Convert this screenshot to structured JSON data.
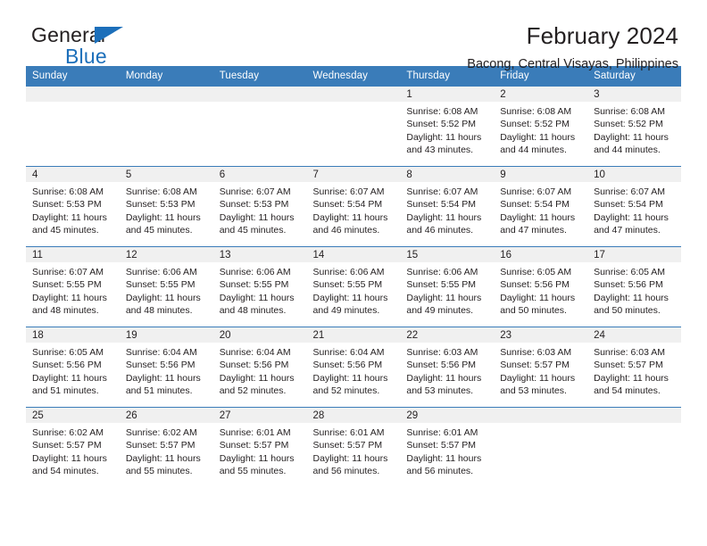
{
  "brand": {
    "name_top": "General",
    "name_bottom": "Blue",
    "triangle_color": "#1c6fba"
  },
  "header": {
    "title": "February 2024",
    "subtitle": "Bacong, Central Visayas, Philippines",
    "accent_color": "#3a7cb9"
  },
  "calendar": {
    "weekday_headers": [
      "Sunday",
      "Monday",
      "Tuesday",
      "Wednesday",
      "Thursday",
      "Friday",
      "Saturday"
    ],
    "weeks": [
      [
        {
          "day": "",
          "lines": []
        },
        {
          "day": "",
          "lines": []
        },
        {
          "day": "",
          "lines": []
        },
        {
          "day": "",
          "lines": []
        },
        {
          "day": "1",
          "lines": [
            "Sunrise: 6:08 AM",
            "Sunset: 5:52 PM",
            "Daylight: 11 hours",
            "and 43 minutes."
          ]
        },
        {
          "day": "2",
          "lines": [
            "Sunrise: 6:08 AM",
            "Sunset: 5:52 PM",
            "Daylight: 11 hours",
            "and 44 minutes."
          ]
        },
        {
          "day": "3",
          "lines": [
            "Sunrise: 6:08 AM",
            "Sunset: 5:52 PM",
            "Daylight: 11 hours",
            "and 44 minutes."
          ]
        }
      ],
      [
        {
          "day": "4",
          "lines": [
            "Sunrise: 6:08 AM",
            "Sunset: 5:53 PM",
            "Daylight: 11 hours",
            "and 45 minutes."
          ]
        },
        {
          "day": "5",
          "lines": [
            "Sunrise: 6:08 AM",
            "Sunset: 5:53 PM",
            "Daylight: 11 hours",
            "and 45 minutes."
          ]
        },
        {
          "day": "6",
          "lines": [
            "Sunrise: 6:07 AM",
            "Sunset: 5:53 PM",
            "Daylight: 11 hours",
            "and 45 minutes."
          ]
        },
        {
          "day": "7",
          "lines": [
            "Sunrise: 6:07 AM",
            "Sunset: 5:54 PM",
            "Daylight: 11 hours",
            "and 46 minutes."
          ]
        },
        {
          "day": "8",
          "lines": [
            "Sunrise: 6:07 AM",
            "Sunset: 5:54 PM",
            "Daylight: 11 hours",
            "and 46 minutes."
          ]
        },
        {
          "day": "9",
          "lines": [
            "Sunrise: 6:07 AM",
            "Sunset: 5:54 PM",
            "Daylight: 11 hours",
            "and 47 minutes."
          ]
        },
        {
          "day": "10",
          "lines": [
            "Sunrise: 6:07 AM",
            "Sunset: 5:54 PM",
            "Daylight: 11 hours",
            "and 47 minutes."
          ]
        }
      ],
      [
        {
          "day": "11",
          "lines": [
            "Sunrise: 6:07 AM",
            "Sunset: 5:55 PM",
            "Daylight: 11 hours",
            "and 48 minutes."
          ]
        },
        {
          "day": "12",
          "lines": [
            "Sunrise: 6:06 AM",
            "Sunset: 5:55 PM",
            "Daylight: 11 hours",
            "and 48 minutes."
          ]
        },
        {
          "day": "13",
          "lines": [
            "Sunrise: 6:06 AM",
            "Sunset: 5:55 PM",
            "Daylight: 11 hours",
            "and 48 minutes."
          ]
        },
        {
          "day": "14",
          "lines": [
            "Sunrise: 6:06 AM",
            "Sunset: 5:55 PM",
            "Daylight: 11 hours",
            "and 49 minutes."
          ]
        },
        {
          "day": "15",
          "lines": [
            "Sunrise: 6:06 AM",
            "Sunset: 5:55 PM",
            "Daylight: 11 hours",
            "and 49 minutes."
          ]
        },
        {
          "day": "16",
          "lines": [
            "Sunrise: 6:05 AM",
            "Sunset: 5:56 PM",
            "Daylight: 11 hours",
            "and 50 minutes."
          ]
        },
        {
          "day": "17",
          "lines": [
            "Sunrise: 6:05 AM",
            "Sunset: 5:56 PM",
            "Daylight: 11 hours",
            "and 50 minutes."
          ]
        }
      ],
      [
        {
          "day": "18",
          "lines": [
            "Sunrise: 6:05 AM",
            "Sunset: 5:56 PM",
            "Daylight: 11 hours",
            "and 51 minutes."
          ]
        },
        {
          "day": "19",
          "lines": [
            "Sunrise: 6:04 AM",
            "Sunset: 5:56 PM",
            "Daylight: 11 hours",
            "and 51 minutes."
          ]
        },
        {
          "day": "20",
          "lines": [
            "Sunrise: 6:04 AM",
            "Sunset: 5:56 PM",
            "Daylight: 11 hours",
            "and 52 minutes."
          ]
        },
        {
          "day": "21",
          "lines": [
            "Sunrise: 6:04 AM",
            "Sunset: 5:56 PM",
            "Daylight: 11 hours",
            "and 52 minutes."
          ]
        },
        {
          "day": "22",
          "lines": [
            "Sunrise: 6:03 AM",
            "Sunset: 5:56 PM",
            "Daylight: 11 hours",
            "and 53 minutes."
          ]
        },
        {
          "day": "23",
          "lines": [
            "Sunrise: 6:03 AM",
            "Sunset: 5:57 PM",
            "Daylight: 11 hours",
            "and 53 minutes."
          ]
        },
        {
          "day": "24",
          "lines": [
            "Sunrise: 6:03 AM",
            "Sunset: 5:57 PM",
            "Daylight: 11 hours",
            "and 54 minutes."
          ]
        }
      ],
      [
        {
          "day": "25",
          "lines": [
            "Sunrise: 6:02 AM",
            "Sunset: 5:57 PM",
            "Daylight: 11 hours",
            "and 54 minutes."
          ]
        },
        {
          "day": "26",
          "lines": [
            "Sunrise: 6:02 AM",
            "Sunset: 5:57 PM",
            "Daylight: 11 hours",
            "and 55 minutes."
          ]
        },
        {
          "day": "27",
          "lines": [
            "Sunrise: 6:01 AM",
            "Sunset: 5:57 PM",
            "Daylight: 11 hours",
            "and 55 minutes."
          ]
        },
        {
          "day": "28",
          "lines": [
            "Sunrise: 6:01 AM",
            "Sunset: 5:57 PM",
            "Daylight: 11 hours",
            "and 56 minutes."
          ]
        },
        {
          "day": "29",
          "lines": [
            "Sunrise: 6:01 AM",
            "Sunset: 5:57 PM",
            "Daylight: 11 hours",
            "and 56 minutes."
          ]
        },
        {
          "day": "",
          "lines": []
        },
        {
          "day": "",
          "lines": []
        }
      ]
    ]
  }
}
